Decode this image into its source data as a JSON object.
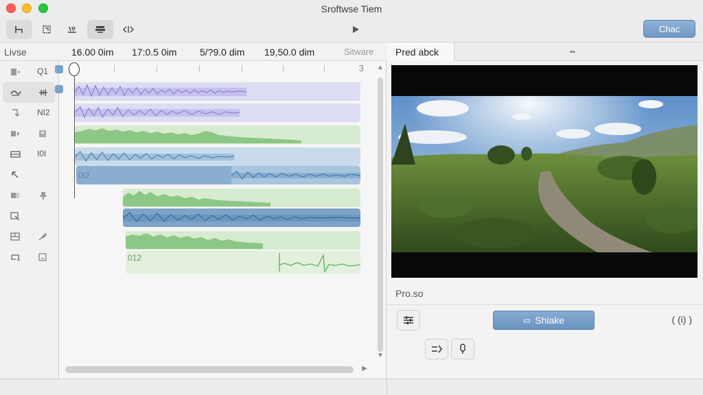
{
  "window": {
    "title": "Sroftwse Tiem"
  },
  "toolbar": {
    "check_label": "Chac"
  },
  "timeline": {
    "panel_label": "Livse",
    "times": [
      "16.00 0im",
      "17:0.5 0im",
      "5/?9.0 dim",
      "19,50.0 dim"
    ],
    "times_extra": "Sitware",
    "ruler_end": "3",
    "track_labels": [
      "Q1",
      "",
      "NI2",
      "",
      "I0I",
      "",
      "",
      "",
      "",
      ""
    ],
    "clip_labels": {
      "blue": "0I2",
      "green": "012"
    }
  },
  "preview": {
    "tab_label": "Pred abck",
    "tab_dots": "••",
    "properties_label": "Pro.so",
    "share_label": "Shiake",
    "paren_label": "( (i) )"
  },
  "colors": {
    "accent": "#6f98c4",
    "purple_wave": "#8478d4",
    "green_wave": "#5fae5a",
    "blue_wave": "#4a7fb0"
  }
}
